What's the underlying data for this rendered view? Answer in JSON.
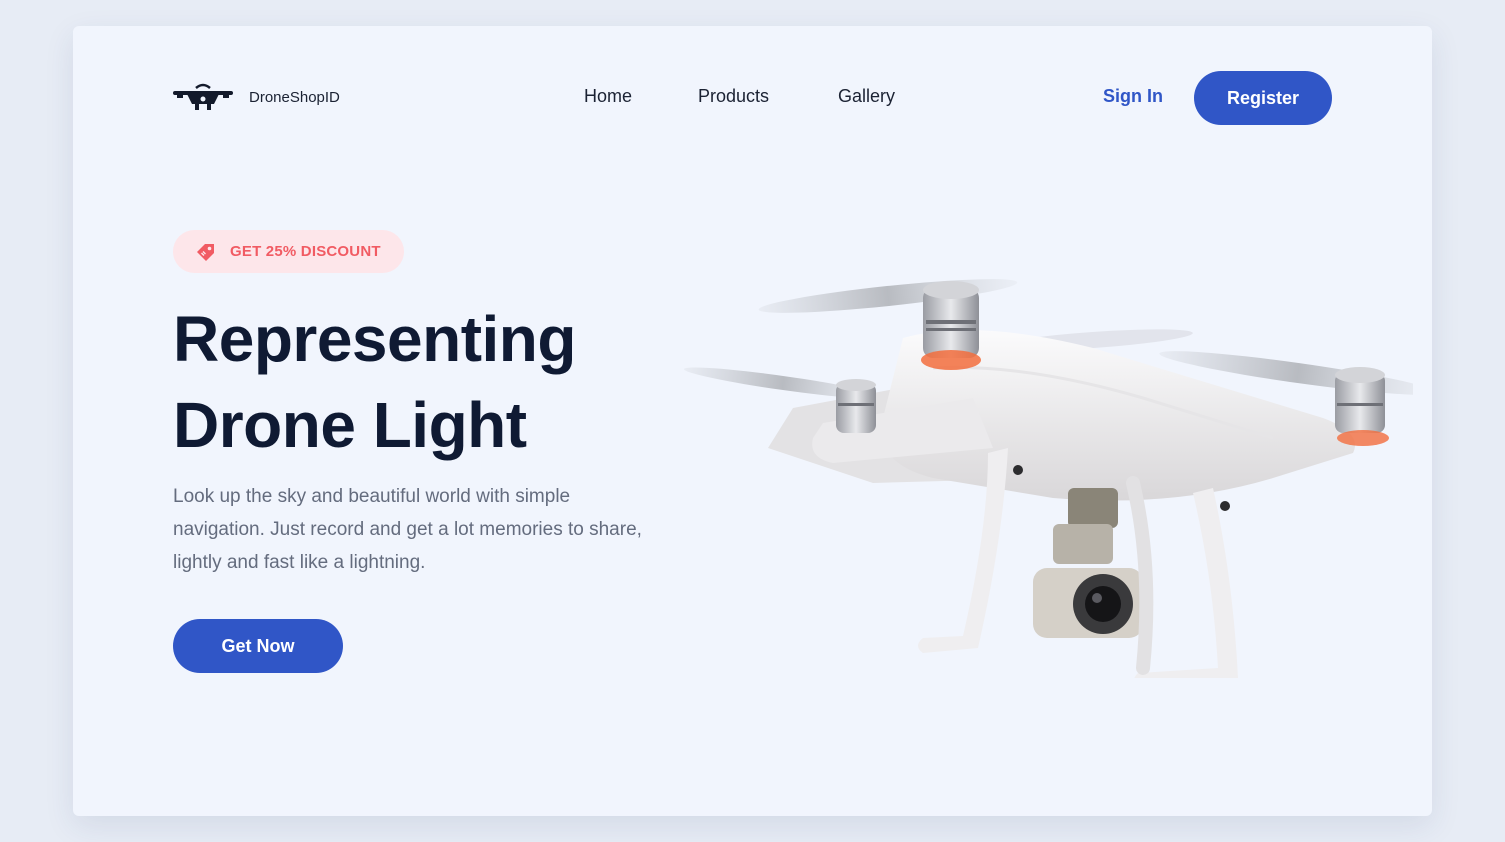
{
  "header": {
    "brand": "DroneShopID",
    "nav": [
      "Home",
      "Products",
      "Gallery"
    ],
    "signin_label": "Sign In",
    "register_label": "Register"
  },
  "hero": {
    "badge": "GET 25% DISCOUNT",
    "headline_line1": "Representing",
    "headline_line2": "Drone Light",
    "description": "Look up the sky and beautiful world with simple navigation. Just record and get a lot memories to share, lightly and fast like a lightning.",
    "cta_label": "Get Now"
  },
  "colors": {
    "primary": "#3056c7",
    "badge_bg": "#fde6ea",
    "badge_text": "#f15b63",
    "heading": "#0f1a33",
    "body_text": "#646c7e",
    "card_bg": "#f1f5fd"
  },
  "icons": {
    "logo": "drone-logo-icon",
    "badge": "price-tag-icon",
    "hero_image": "quadcopter-drone-image"
  }
}
